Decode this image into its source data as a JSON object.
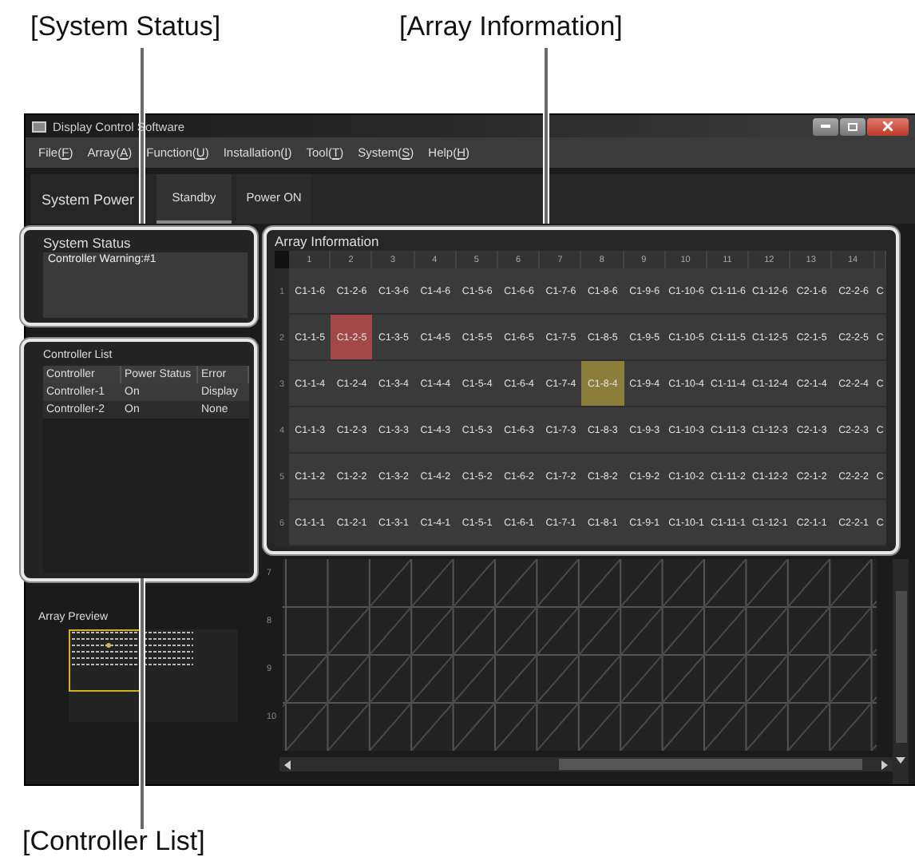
{
  "callouts": {
    "system_status": "[System Status]",
    "array_information": "[Array Information]",
    "controller_list": "[Controller List]"
  },
  "window": {
    "title": "Display Control Software"
  },
  "menu": [
    {
      "before": "File(",
      "key": "F",
      "after": ")"
    },
    {
      "before": "Array(",
      "key": "A",
      "after": ")"
    },
    {
      "before": "Function(",
      "key": "U",
      "after": ")"
    },
    {
      "before": "Installation(",
      "key": "I",
      "after": ")"
    },
    {
      "before": "Tool(",
      "key": "T",
      "after": ")"
    },
    {
      "before": "System(",
      "key": "S",
      "after": ")"
    },
    {
      "before": "Help(",
      "key": "H",
      "after": ")"
    }
  ],
  "system_power": {
    "label": "System Power",
    "buttons": [
      {
        "label": "Standby",
        "selected": true
      },
      {
        "label": "Power ON",
        "selected": false
      }
    ]
  },
  "system_status": {
    "title": "System Status",
    "messages": [
      "Controller Warning:#1"
    ]
  },
  "controller_list": {
    "title": "Controller List",
    "columns": [
      "Controller",
      "Power Status",
      "Error"
    ],
    "rows": [
      {
        "cells": [
          "Controller-1",
          "On",
          "Display"
        ],
        "selected": true
      },
      {
        "cells": [
          "Controller-2",
          "On",
          "None"
        ],
        "selected": false
      }
    ]
  },
  "array_preview": {
    "title": "Array Preview"
  },
  "array_information": {
    "title": "Array Information",
    "columns": [
      "1",
      "2",
      "3",
      "4",
      "5",
      "6",
      "7",
      "8",
      "9",
      "10",
      "11",
      "12",
      "13",
      "14"
    ],
    "rows": [
      {
        "label": "1",
        "cells": [
          {
            "text": "C1-1-6"
          },
          {
            "text": "C1-2-6"
          },
          {
            "text": "C1-3-6"
          },
          {
            "text": "C1-4-6"
          },
          {
            "text": "C1-5-6"
          },
          {
            "text": "C1-6-6"
          },
          {
            "text": "C1-7-6"
          },
          {
            "text": "C1-8-6"
          },
          {
            "text": "C1-9-6"
          },
          {
            "text": "C1-10-6"
          },
          {
            "text": "C1-11-6"
          },
          {
            "text": "C1-12-6"
          },
          {
            "text": "C2-1-6"
          },
          {
            "text": "C2-2-6"
          },
          {
            "text": "C"
          }
        ]
      },
      {
        "label": "2",
        "cells": [
          {
            "text": "C1-1-5"
          },
          {
            "text": "C1-2-5",
            "color": "#a34848"
          },
          {
            "text": "C1-3-5"
          },
          {
            "text": "C1-4-5"
          },
          {
            "text": "C1-5-5"
          },
          {
            "text": "C1-6-5"
          },
          {
            "text": "C1-7-5"
          },
          {
            "text": "C1-8-5"
          },
          {
            "text": "C1-9-5"
          },
          {
            "text": "C1-10-5"
          },
          {
            "text": "C1-11-5"
          },
          {
            "text": "C1-12-5"
          },
          {
            "text": "C2-1-5"
          },
          {
            "text": "C2-2-5"
          },
          {
            "text": "C"
          }
        ]
      },
      {
        "label": "3",
        "cells": [
          {
            "text": "C1-1-4"
          },
          {
            "text": "C1-2-4"
          },
          {
            "text": "C1-3-4"
          },
          {
            "text": "C1-4-4"
          },
          {
            "text": "C1-5-4"
          },
          {
            "text": "C1-6-4"
          },
          {
            "text": "C1-7-4"
          },
          {
            "text": "C1-8-4",
            "color": "#8c7d3a"
          },
          {
            "text": "C1-9-4"
          },
          {
            "text": "C1-10-4"
          },
          {
            "text": "C1-11-4"
          },
          {
            "text": "C1-12-4"
          },
          {
            "text": "C2-1-4"
          },
          {
            "text": "C2-2-4"
          },
          {
            "text": "C"
          }
        ]
      },
      {
        "label": "4",
        "cells": [
          {
            "text": "C1-1-3"
          },
          {
            "text": "C1-2-3"
          },
          {
            "text": "C1-3-3"
          },
          {
            "text": "C1-4-3"
          },
          {
            "text": "C1-5-3"
          },
          {
            "text": "C1-6-3"
          },
          {
            "text": "C1-7-3"
          },
          {
            "text": "C1-8-3"
          },
          {
            "text": "C1-9-3"
          },
          {
            "text": "C1-10-3"
          },
          {
            "text": "C1-11-3"
          },
          {
            "text": "C1-12-3"
          },
          {
            "text": "C2-1-3"
          },
          {
            "text": "C2-2-3"
          },
          {
            "text": "C"
          }
        ]
      },
      {
        "label": "5",
        "cells": [
          {
            "text": "C1-1-2"
          },
          {
            "text": "C1-2-2"
          },
          {
            "text": "C1-3-2"
          },
          {
            "text": "C1-4-2"
          },
          {
            "text": "C1-5-2"
          },
          {
            "text": "C1-6-2"
          },
          {
            "text": "C1-7-2"
          },
          {
            "text": "C1-8-2"
          },
          {
            "text": "C1-9-2"
          },
          {
            "text": "C1-10-2"
          },
          {
            "text": "C1-11-2"
          },
          {
            "text": "C1-12-2"
          },
          {
            "text": "C2-1-2"
          },
          {
            "text": "C2-2-2"
          },
          {
            "text": "C"
          }
        ]
      },
      {
        "label": "6",
        "cells": [
          {
            "text": "C1-1-1"
          },
          {
            "text": "C1-2-1"
          },
          {
            "text": "C1-3-1"
          },
          {
            "text": "C1-4-1"
          },
          {
            "text": "C1-5-1"
          },
          {
            "text": "C1-6-1"
          },
          {
            "text": "C1-7-1"
          },
          {
            "text": "C1-8-1"
          },
          {
            "text": "C1-9-1"
          },
          {
            "text": "C1-10-1"
          },
          {
            "text": "C1-11-1"
          },
          {
            "text": "C1-12-1"
          },
          {
            "text": "C2-1-1"
          },
          {
            "text": "C2-2-1"
          },
          {
            "text": "C"
          }
        ]
      }
    ],
    "empty_rows": [
      "7",
      "8",
      "9",
      "10"
    ]
  }
}
